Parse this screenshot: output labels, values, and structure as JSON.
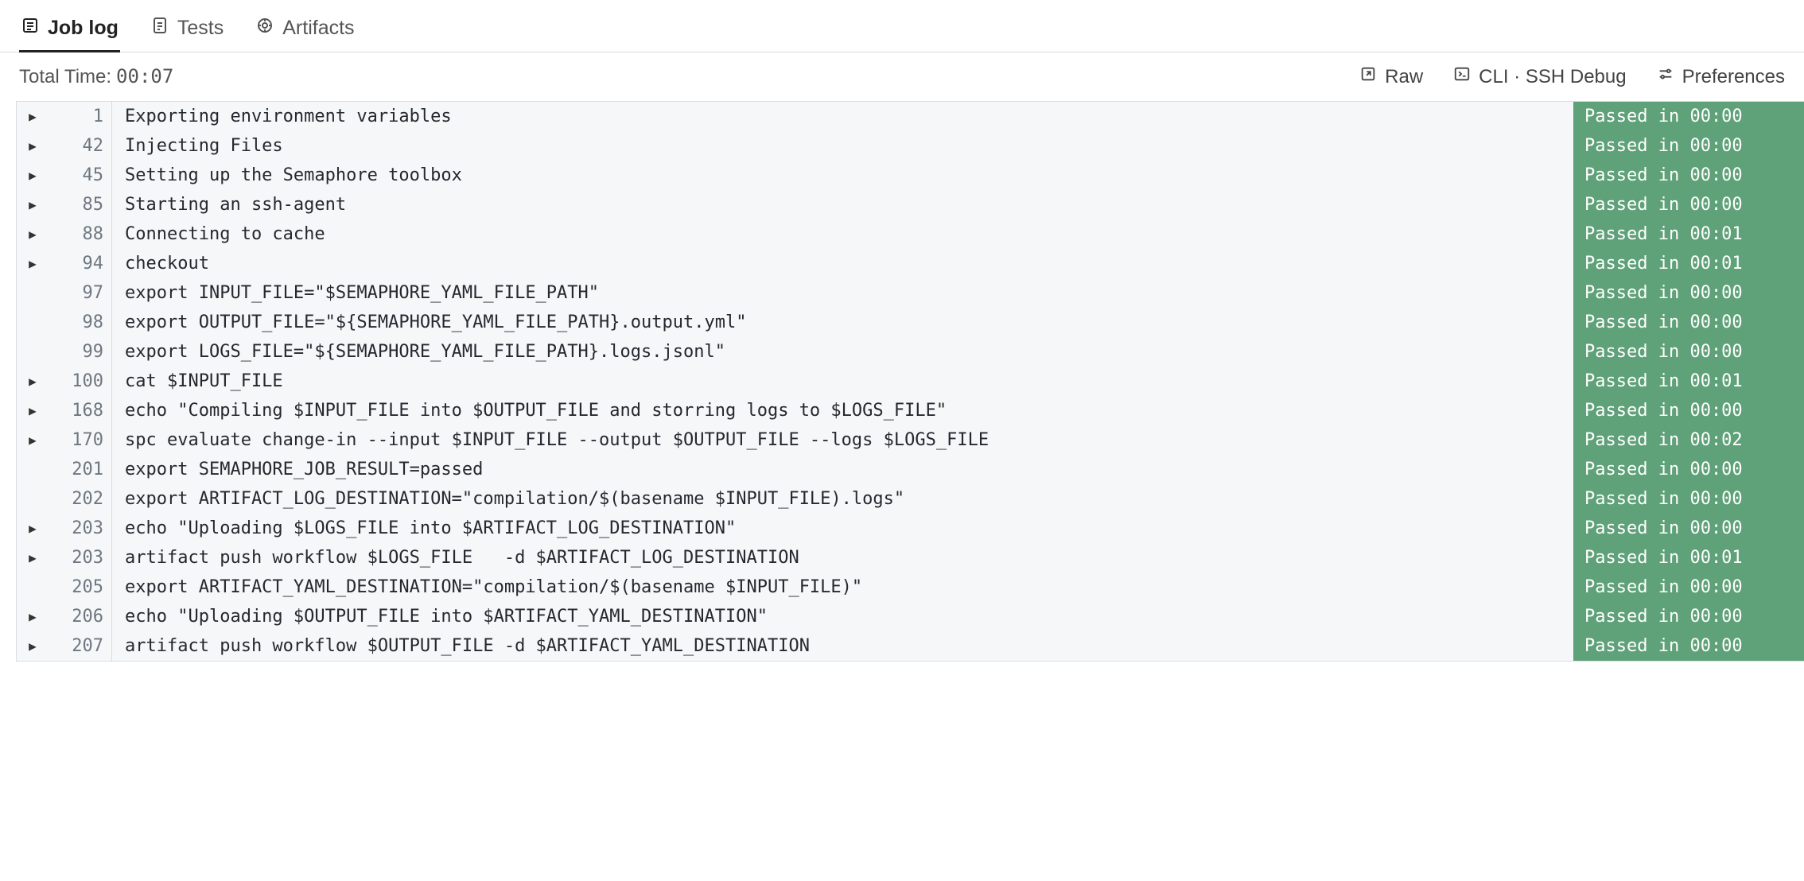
{
  "tabs": {
    "job_log": "Job log",
    "tests": "Tests",
    "artifacts": "Artifacts"
  },
  "toolbar": {
    "total_time_label": "Total Time: ",
    "total_time_value": "00:07",
    "raw": "Raw",
    "cli_ssh": "CLI · SSH Debug",
    "preferences": "Preferences"
  },
  "log": [
    {
      "expand": true,
      "line": "1",
      "cmd": "Exporting environment variables",
      "status": "Passed in 00:00"
    },
    {
      "expand": true,
      "line": "42",
      "cmd": "Injecting Files",
      "status": "Passed in 00:00"
    },
    {
      "expand": true,
      "line": "45",
      "cmd": "Setting up the Semaphore toolbox",
      "status": "Passed in 00:00"
    },
    {
      "expand": true,
      "line": "85",
      "cmd": "Starting an ssh-agent",
      "status": "Passed in 00:00"
    },
    {
      "expand": true,
      "line": "88",
      "cmd": "Connecting to cache",
      "status": "Passed in 00:01"
    },
    {
      "expand": true,
      "line": "94",
      "cmd": "checkout",
      "status": "Passed in 00:01"
    },
    {
      "expand": false,
      "line": "97",
      "cmd": "export INPUT_FILE=\"$SEMAPHORE_YAML_FILE_PATH\"",
      "status": "Passed in 00:00"
    },
    {
      "expand": false,
      "line": "98",
      "cmd": "export OUTPUT_FILE=\"${SEMAPHORE_YAML_FILE_PATH}.output.yml\"",
      "status": "Passed in 00:00"
    },
    {
      "expand": false,
      "line": "99",
      "cmd": "export LOGS_FILE=\"${SEMAPHORE_YAML_FILE_PATH}.logs.jsonl\"",
      "status": "Passed in 00:00"
    },
    {
      "expand": true,
      "line": "100",
      "cmd": "cat $INPUT_FILE",
      "status": "Passed in 00:01"
    },
    {
      "expand": true,
      "line": "168",
      "cmd": "echo \"Compiling $INPUT_FILE into $OUTPUT_FILE and storring logs to $LOGS_FILE\"",
      "status": "Passed in 00:00"
    },
    {
      "expand": true,
      "line": "170",
      "cmd": "spc evaluate change-in --input $INPUT_FILE --output $OUTPUT_FILE --logs $LOGS_FILE",
      "status": "Passed in 00:02"
    },
    {
      "expand": false,
      "line": "201",
      "cmd": "export SEMAPHORE_JOB_RESULT=passed",
      "status": "Passed in 00:00"
    },
    {
      "expand": false,
      "line": "202",
      "cmd": "export ARTIFACT_LOG_DESTINATION=\"compilation/$(basename $INPUT_FILE).logs\"",
      "status": "Passed in 00:00"
    },
    {
      "expand": true,
      "line": "203",
      "cmd": "echo \"Uploading $LOGS_FILE into $ARTIFACT_LOG_DESTINATION\"",
      "status": "Passed in 00:00"
    },
    {
      "expand": true,
      "line": "203",
      "cmd": "artifact push workflow $LOGS_FILE   -d $ARTIFACT_LOG_DESTINATION",
      "status": "Passed in 00:01"
    },
    {
      "expand": false,
      "line": "205",
      "cmd": "export ARTIFACT_YAML_DESTINATION=\"compilation/$(basename $INPUT_FILE)\"",
      "status": "Passed in 00:00"
    },
    {
      "expand": true,
      "line": "206",
      "cmd": "echo \"Uploading $OUTPUT_FILE into $ARTIFACT_YAML_DESTINATION\"",
      "status": "Passed in 00:00"
    },
    {
      "expand": true,
      "line": "207",
      "cmd": "artifact push workflow $OUTPUT_FILE -d $ARTIFACT_YAML_DESTINATION",
      "status": "Passed in 00:00"
    }
  ]
}
